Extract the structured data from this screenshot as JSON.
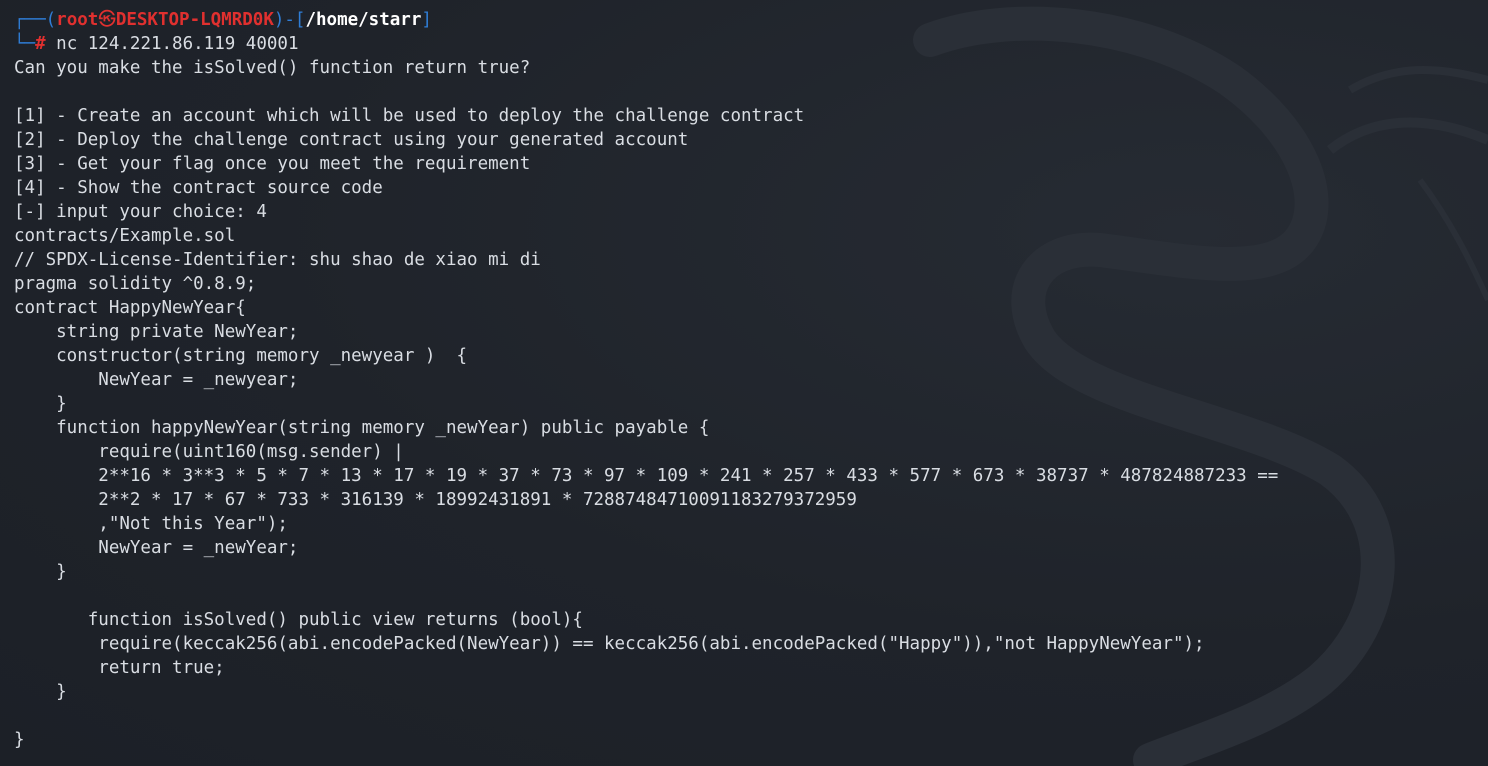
{
  "prompt": {
    "corner_top": "┌──(",
    "user": "root",
    "skull": "㉿",
    "host": "DESKTOP-LQMRD0K",
    "sep": ")-[",
    "path": "/home/starr",
    "close": "]",
    "corner_bottom": "└─",
    "hash": "#",
    "command": " nc 124.221.86.119 40001"
  },
  "output_lines": [
    "Can you make the isSolved() function return true?",
    "",
    "[1] - Create an account which will be used to deploy the challenge contract",
    "[2] - Deploy the challenge contract using your generated account",
    "[3] - Get your flag once you meet the requirement",
    "[4] - Show the contract source code",
    "[-] input your choice: 4",
    "contracts/Example.sol",
    "// SPDX-License-Identifier: shu shao de xiao mi di",
    "pragma solidity ^0.8.9;",
    "contract HappyNewYear{",
    "    string private NewYear;",
    "    constructor(string memory _newyear )  {",
    "        NewYear = _newyear;",
    "    }",
    "    function happyNewYear(string memory _newYear) public payable {",
    "        require(uint160(msg.sender) |",
    "        2**16 * 3**3 * 5 * 7 * 13 * 17 * 19 * 37 * 73 * 97 * 109 * 241 * 257 * 433 * 577 * 673 * 38737 * 487824887233 ==",
    "        2**2 * 17 * 67 * 733 * 316139 * 18992431891 * 72887484710091183279372959",
    "        ,\"Not this Year\");",
    "        NewYear = _newYear;",
    "    }",
    "",
    "       function isSolved() public view returns (bool){",
    "        require(keccak256(abi.encodePacked(NewYear)) == keccak256(abi.encodePacked(\"Happy\")),\"not HappyNewYear\");",
    "        return true;",
    "    }",
    "",
    "}"
  ]
}
